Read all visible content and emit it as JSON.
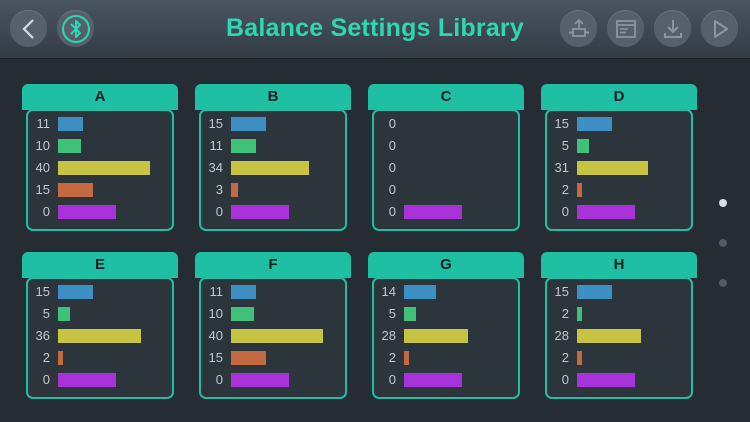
{
  "header": {
    "title": "Balance Settings Library",
    "back_icon": "chevron-left-icon",
    "bluetooth_icon": "bluetooth-icon",
    "right_icons": [
      "robot-upload-icon",
      "document-icon",
      "download-icon",
      "play-icon"
    ]
  },
  "colors": {
    "accent": "#2fd6b4",
    "card_header": "#1fbfa4",
    "bars": [
      "#3e8fc4",
      "#3fc17a",
      "#c8c443",
      "#c46a40",
      "#a833d8"
    ]
  },
  "bar_max_value": 40,
  "cards": [
    {
      "label": "A",
      "values": [
        11,
        10,
        40,
        15,
        0
      ]
    },
    {
      "label": "B",
      "values": [
        15,
        11,
        34,
        3,
        0
      ]
    },
    {
      "label": "C",
      "values": [
        0,
        0,
        0,
        0,
        0
      ]
    },
    {
      "label": "D",
      "values": [
        15,
        5,
        31,
        2,
        0
      ]
    },
    {
      "label": "E",
      "values": [
        15,
        5,
        36,
        2,
        0
      ]
    },
    {
      "label": "F",
      "values": [
        11,
        10,
        40,
        15,
        0
      ]
    },
    {
      "label": "G",
      "values": [
        14,
        5,
        28,
        2,
        0
      ]
    },
    {
      "label": "H",
      "values": [
        15,
        2,
        28,
        2,
        0
      ]
    }
  ],
  "pagination": {
    "pages": 3,
    "active": 0
  }
}
